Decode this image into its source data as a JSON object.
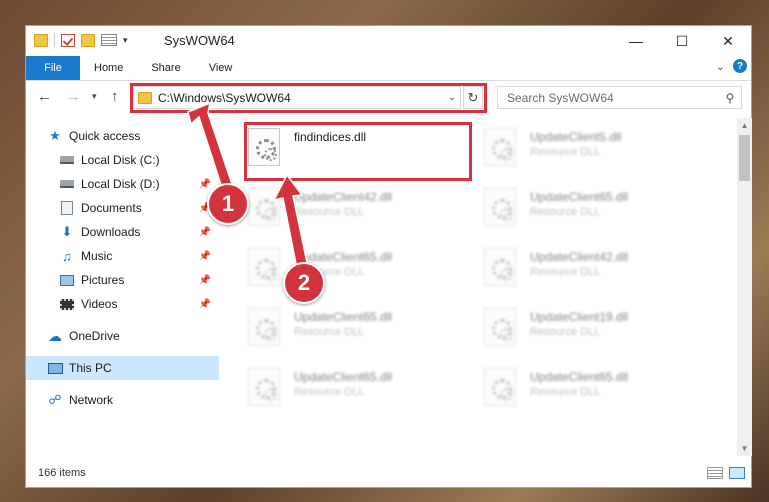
{
  "window": {
    "title": "SysWOW64"
  },
  "ribbon": {
    "tabs": [
      "File",
      "Home",
      "Share",
      "View"
    ]
  },
  "nav": {
    "path": "C:\\Windows\\SysWOW64",
    "search_placeholder": "Search SysWOW64"
  },
  "sidebar": {
    "items": [
      {
        "label": "Quick access",
        "icon": "star-icon"
      },
      {
        "label": "Local Disk (C:)",
        "icon": "disk-icon"
      },
      {
        "label": "Local Disk (D:)",
        "icon": "disk-icon"
      },
      {
        "label": "Documents",
        "icon": "document-icon"
      },
      {
        "label": "Downloads",
        "icon": "download-icon"
      },
      {
        "label": "Music",
        "icon": "music-icon"
      },
      {
        "label": "Pictures",
        "icon": "picture-icon"
      },
      {
        "label": "Videos",
        "icon": "video-icon"
      },
      {
        "label": "OneDrive",
        "icon": "cloud-icon"
      },
      {
        "label": "This PC",
        "icon": "computer-icon"
      },
      {
        "label": "Network",
        "icon": "network-icon"
      }
    ]
  },
  "files": [
    {
      "name": "findindices.dll",
      "type": ""
    },
    {
      "name": "UpdateClient5.dll",
      "type": "Resource DLL"
    },
    {
      "name": "UpdateClient42.dll",
      "type": "Resource DLL"
    },
    {
      "name": "UpdateClient65.dll",
      "type": "Resource DLL"
    },
    {
      "name": "UpdateClient65.dll",
      "type": "Resource DLL"
    },
    {
      "name": "UpdateClient42.dll",
      "type": "Resource DLL"
    },
    {
      "name": "UpdateClient65.dll",
      "type": "Resource DLL"
    },
    {
      "name": "UpdateClient19.dll",
      "type": "Resource DLL"
    },
    {
      "name": "UpdateClient65.dll",
      "type": "Resource DLL"
    },
    {
      "name": "UpdateClient65.dll",
      "type": "Resource DLL"
    }
  ],
  "status": {
    "item_count": "166 items"
  },
  "annotations": {
    "marker_1": "1",
    "marker_2": "2"
  },
  "colors": {
    "accent": "#1979ca",
    "highlight": "#d3333c",
    "selection": "#cce8ff"
  }
}
